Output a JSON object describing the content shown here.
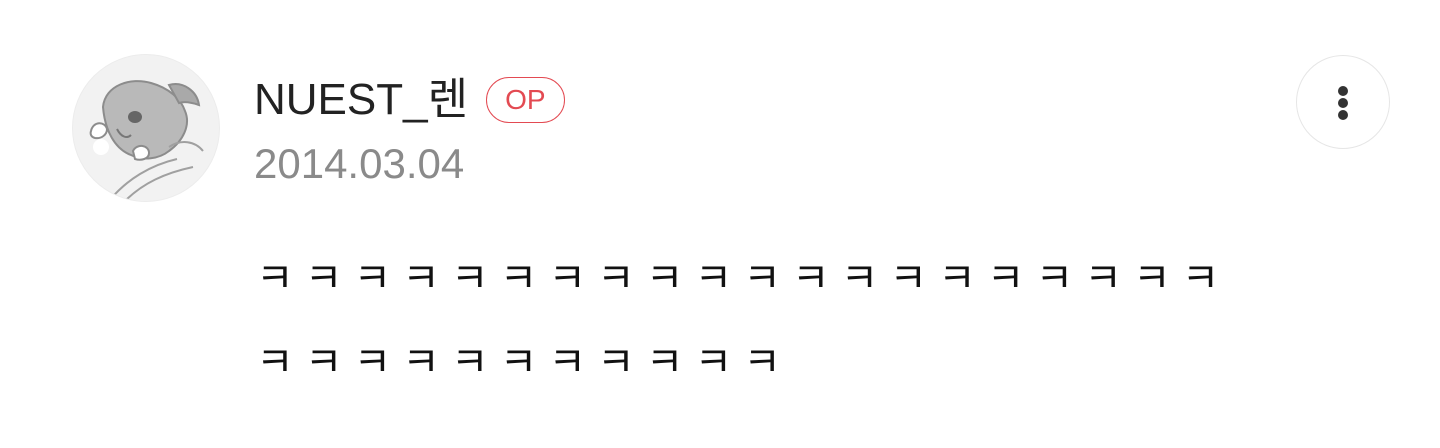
{
  "comment": {
    "author": "NUEST_렌",
    "badge": "OP",
    "date": "2014.03.04",
    "text": "ㅋㅋㅋㅋㅋㅋㅋㅋㅋㅋㅋㅋㅋㅋㅋㅋㅋㅋㅋㅋ\nㅋㅋㅋㅋㅋㅋㅋㅋㅋㅋㅋ"
  },
  "icons": {
    "avatar": "cartoon-dog-avatar",
    "more": "more-vertical-icon"
  },
  "colors": {
    "badge": "#e34a52",
    "date": "#8a8a8a",
    "author": "#222222"
  }
}
